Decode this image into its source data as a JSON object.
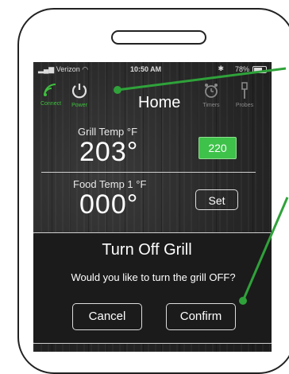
{
  "status_bar": {
    "carrier": "Verizon",
    "time": "10:50 AM",
    "battery": "78%"
  },
  "nav": {
    "connect_label": "Connect",
    "power_label": "Power",
    "title": "Home",
    "timers_label": "Timers",
    "probes_label": "Probes"
  },
  "grill": {
    "label": "Grill Temp °F",
    "value": "203°",
    "setpoint": "220"
  },
  "food": {
    "label": "Food Temp 1 °F",
    "value": "000°",
    "set_label": "Set"
  },
  "dialog": {
    "title": "Turn Off Grill",
    "message": "Would you like to turn the grill OFF?",
    "cancel_label": "Cancel",
    "confirm_label": "Confirm"
  },
  "colors": {
    "accent_green": "#3ec24a",
    "callout_green": "#2fa23a",
    "background": "#262626"
  }
}
